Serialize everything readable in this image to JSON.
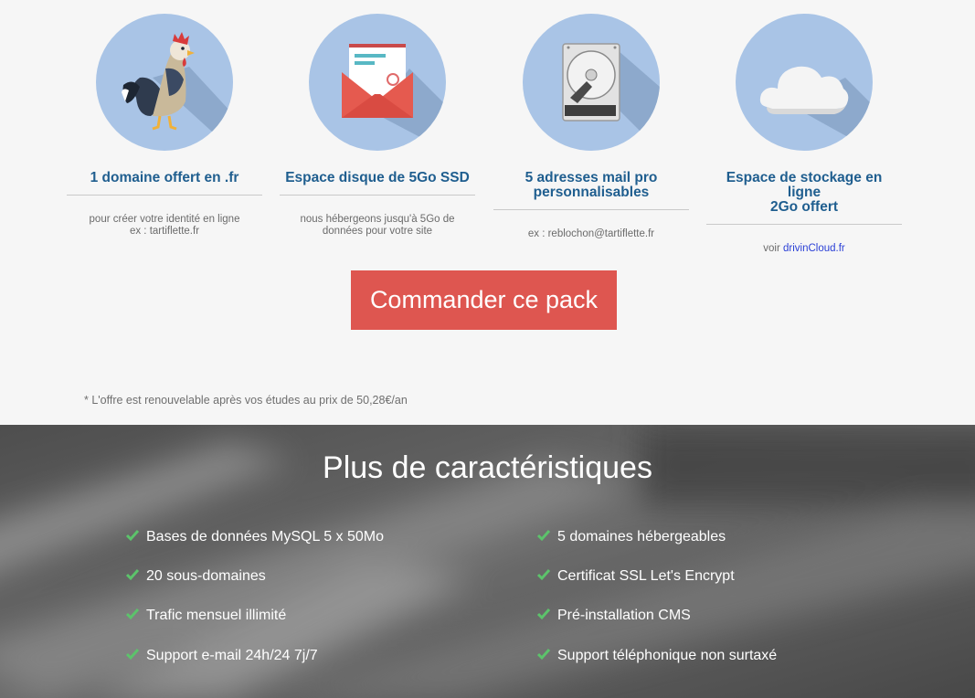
{
  "features": [
    {
      "icon": "rooster-icon",
      "title": [
        "1 domaine offert en .fr"
      ],
      "desc": [
        "pour créer votre identité en ligne",
        "ex : tartiflette.fr"
      ]
    },
    {
      "icon": "envelope-icon",
      "title": [
        "Espace disque de 5Go SSD"
      ],
      "desc": [
        "nous hébergeons jusqu'à 5Go de",
        "données pour votre site"
      ]
    },
    {
      "icon": "hard-drive-icon",
      "title": [
        "5 adresses mail pro",
        "personnalisables"
      ],
      "desc": [
        "ex : reblochon@tartiflette.fr"
      ]
    },
    {
      "icon": "cloud-icon",
      "title": [
        "Espace de stockage en ligne",
        "2Go offert"
      ],
      "desc_prefix": "voir ",
      "desc_link": "drivinCloud.fr"
    }
  ],
  "cta_label": "Commander ce pack",
  "footnote": "* L'offre est renouvelable après vos études au prix de 50,28€/an",
  "specs_title": "Plus de caractéristiques",
  "specs_left": [
    "Bases de données MySQL 5 x 50Mo",
    "20 sous-domaines",
    "Trafic mensuel illimité",
    "Support e-mail 24h/24 7j/7"
  ],
  "specs_right": [
    "5 domaines hébergeables",
    "Certificat SSL Let's Encrypt",
    "Pré-installation CMS",
    "Support téléphonique non surtaxé"
  ],
  "colors": {
    "title": "#1f5e8f",
    "circle": "#a9c4e6",
    "cta": "#de5650",
    "check": "#5cc36b"
  }
}
